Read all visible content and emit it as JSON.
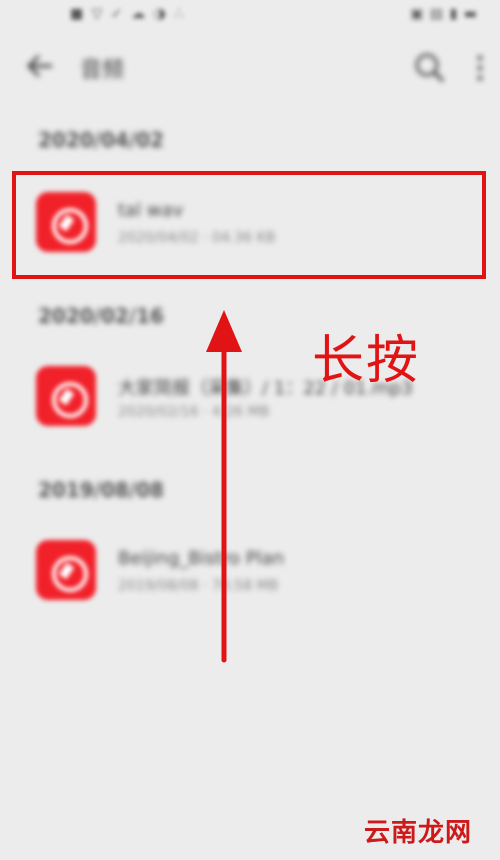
{
  "status_bar": {
    "left_icons": "■ ▽ ✓ ☁ ◑ ∴",
    "right_icons": "▣ ▤ ▮ ▬"
  },
  "app_bar": {
    "title": "音频",
    "back_icon": "arrow-left-icon",
    "search_icon": "search-icon",
    "more_icon": "more-vertical-icon"
  },
  "sections": [
    {
      "date": "2020/04/02",
      "files": [
        {
          "name": "tal wav",
          "meta": "2020/04/02 · 04.36 KB"
        }
      ]
    },
    {
      "date": "2020/02/16",
      "files": [
        {
          "name": "大家简报（采集）/ 1：22 / 01.mp3",
          "meta": "2020/02/16 · 4.26 MB"
        }
      ]
    },
    {
      "date": "2019/08/08",
      "files": [
        {
          "name": "Beijing_Bistro Plan",
          "meta": "2019/08/08 · 70.58 MB"
        }
      ]
    }
  ],
  "annotation": {
    "label": "长按"
  },
  "watermark": "云南龙网",
  "colors": {
    "accent": "#e01414",
    "icon_red": "#f1212a",
    "background": "#ececec"
  }
}
